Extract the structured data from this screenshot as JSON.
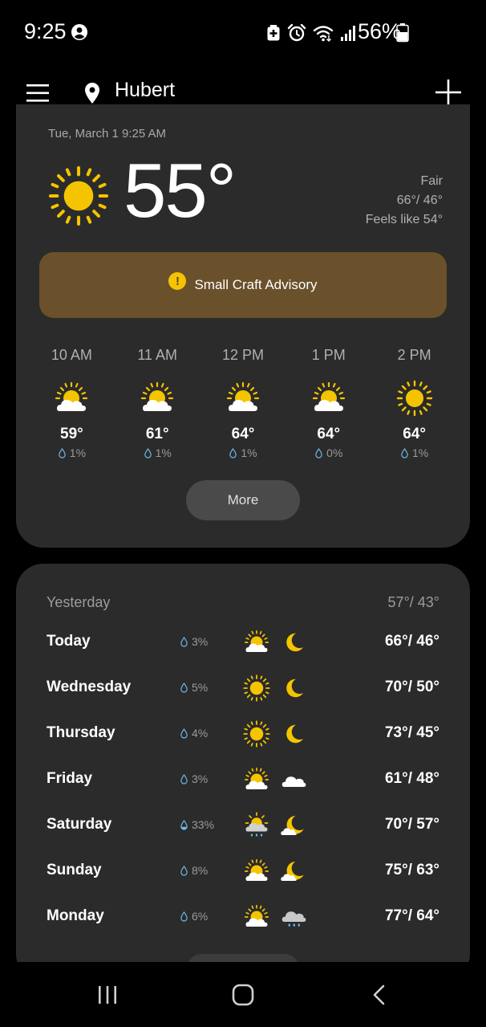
{
  "status_bar": {
    "time": "9:25",
    "battery": "56%",
    "icons": [
      "account-circle-icon",
      "battery-saver-icon",
      "alarm-icon",
      "wifi-icon",
      "signal-icon",
      "battery-icon"
    ]
  },
  "app_bar": {
    "location": "Hubert",
    "menu_icon": "hamburger-menu-icon",
    "add_icon": "plus-icon"
  },
  "current": {
    "updated": "Tue, March 1 9:25 AM",
    "temperature": "55°",
    "condition": "Fair",
    "hi_lo": "66°/ 46°",
    "feels_like": "Feels like 54°",
    "icon": "sunny-icon"
  },
  "advisory": {
    "text": "Small Craft Advisory",
    "icon": "warning-icon"
  },
  "hourly": [
    {
      "time": "10 AM",
      "temp": "59°",
      "precip": "1%",
      "icon": "partly-cloudy-icon"
    },
    {
      "time": "11 AM",
      "temp": "61°",
      "precip": "1%",
      "icon": "partly-cloudy-icon"
    },
    {
      "time": "12 PM",
      "temp": "64°",
      "precip": "1%",
      "icon": "partly-cloudy-icon"
    },
    {
      "time": "1 PM",
      "temp": "64°",
      "precip": "0%",
      "icon": "partly-cloudy-icon"
    },
    {
      "time": "2 PM",
      "temp": "64°",
      "precip": "1%",
      "icon": "sunny-icon"
    }
  ],
  "more_label": "More",
  "daily": {
    "yesterday_label": "Yesterday",
    "yesterday_temps": "57°/ 43°",
    "days": [
      {
        "name": "Today",
        "precip": "3%",
        "day_icon": "partly-cloudy-icon",
        "night_icon": "moon-icon",
        "temps": "66°/ 46°"
      },
      {
        "name": "Wednesday",
        "precip": "5%",
        "day_icon": "sunny-icon",
        "night_icon": "moon-icon",
        "temps": "70°/ 50°"
      },
      {
        "name": "Thursday",
        "precip": "4%",
        "day_icon": "sunny-icon",
        "night_icon": "moon-icon",
        "temps": "73°/ 45°"
      },
      {
        "name": "Friday",
        "precip": "3%",
        "day_icon": "partly-cloudy-icon",
        "night_icon": "cloud-icon",
        "temps": "61°/ 48°"
      },
      {
        "name": "Saturday",
        "precip": "33%",
        "day_icon": "partly-cloudy-rain-icon",
        "night_icon": "partly-cloudy-night-icon",
        "temps": "70°/ 57°"
      },
      {
        "name": "Sunday",
        "precip": "8%",
        "day_icon": "partly-cloudy-icon",
        "night_icon": "partly-cloudy-night-icon",
        "temps": "75°/ 63°"
      },
      {
        "name": "Monday",
        "precip": "6%",
        "day_icon": "partly-cloudy-icon",
        "night_icon": "rain-cloud-icon",
        "temps": "77°/ 64°"
      }
    ]
  },
  "nav_bar": {
    "icons": [
      "recents-icon",
      "home-icon",
      "back-icon"
    ]
  },
  "colors": {
    "background": "#000000",
    "card": "#2b2b2b",
    "advisory": "#6a512b",
    "sun": "#f5c400",
    "muted_text": "#a8a8a8"
  }
}
